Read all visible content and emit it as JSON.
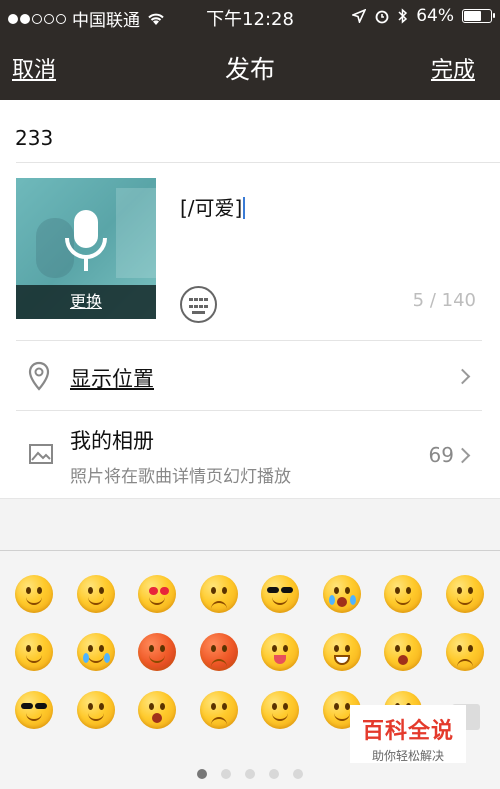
{
  "status_bar": {
    "carrier": "中国联通",
    "time": "下午12:28",
    "battery": "64%",
    "battery_level": 0.64,
    "signal_bars_filled": 2,
    "signal_bars_total": 5
  },
  "nav": {
    "cancel_label": "取消",
    "title": "发布",
    "done_label": "完成"
  },
  "post": {
    "title_text": "233",
    "cover_change_label": "更换",
    "description_text": "[/可爱]",
    "char_counter": "5 / 140"
  },
  "rows": [
    {
      "label": "显示位置",
      "icon": "location-pin-icon"
    },
    {
      "label": "我的相册",
      "sublabel": "照片将在歌曲详情页幻灯播放",
      "value": "69",
      "icon": "photo-album-icon"
    }
  ],
  "emoji_keyboard": {
    "page_count": 5,
    "active_page": 1,
    "rows": [
      [
        "smile",
        "shy",
        "heart-eyes",
        "angry-sweat",
        "sunglasses",
        "cry",
        "squint",
        "zipped"
      ],
      [
        "sleepy",
        "tears",
        "blush-red",
        "angry-red",
        "tongue",
        "grin",
        "surprised",
        "sad"
      ],
      [
        "cool",
        "dizzy-shy",
        "scared",
        "confused",
        "yawn",
        "smile-2",
        "peek"
      ]
    ]
  },
  "watermark": {
    "title": "百科全说",
    "subtitle": "助你轻松解决"
  },
  "colors": {
    "nav_bg": "#2f2b28",
    "accent_caret": "#3a7bd5",
    "watermark_red": "#e43a2c"
  }
}
